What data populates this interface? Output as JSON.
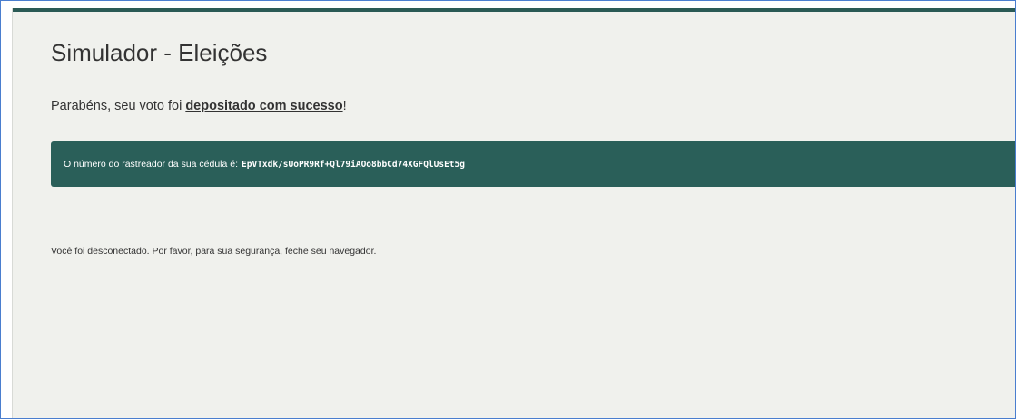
{
  "page": {
    "title": "Simulador - Eleições"
  },
  "confirmation": {
    "prefix": "Parabéns, seu voto foi ",
    "emphasis": "depositado com sucesso",
    "suffix": "!"
  },
  "tracker": {
    "label": "O número do rastreador da sua cédula é:",
    "code": "EpVTxdk/sUoPR9Rf+Ql79iAOo8bbCd74XGFQlUsEt5g"
  },
  "logout_notice": "Você foi desconectado. Por favor, para sua segurança, feche seu navegador.",
  "colors": {
    "accent": "#2a5f59",
    "background": "#f0f1ed",
    "text": "#333333"
  }
}
